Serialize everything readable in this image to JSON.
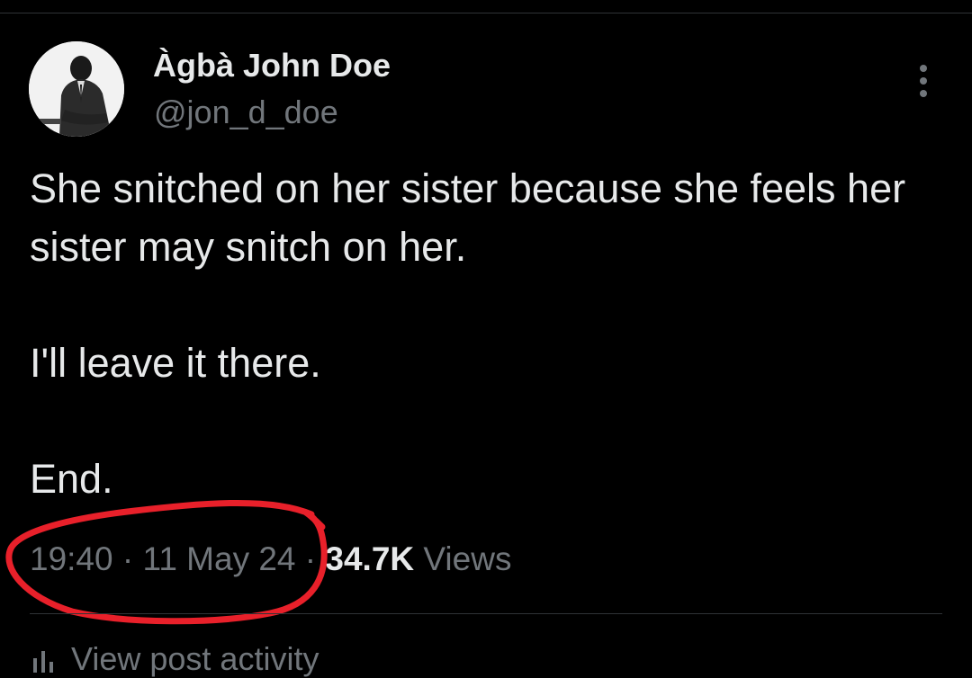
{
  "author": {
    "display_name": "Àgbà John Doe",
    "handle": "@jon_d_doe",
    "avatar_icon": "profile-photo-man-in-suit"
  },
  "tweet": {
    "paragraphs": [
      "She snitched on her sister because she feels her sister may snitch on her.",
      "I'll leave it there.",
      "End."
    ],
    "time": "19:40",
    "separator": " · ",
    "date": "11 May 24",
    "views_count": "34.7K",
    "views_label": "Views"
  },
  "footer": {
    "activity_label": "View post activity",
    "activity_icon": "bar-chart-icon"
  },
  "annotation": {
    "type": "hand-drawn circle around timestamp",
    "color": "#e8202a"
  },
  "colors": {
    "background": "#000000",
    "primary_text": "#e7e9ea",
    "secondary_text": "#71767b",
    "divider": "#2f3336"
  }
}
